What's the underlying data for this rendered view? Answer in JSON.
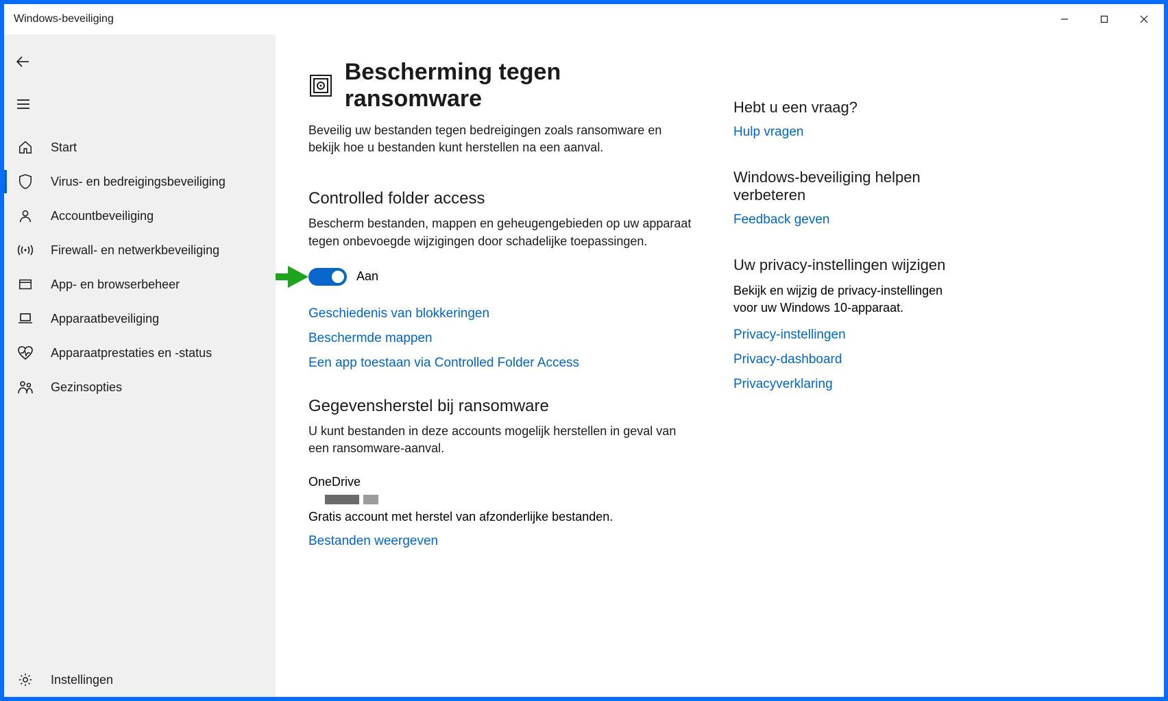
{
  "window": {
    "title": "Windows-beveiliging"
  },
  "sidebar": {
    "items": [
      {
        "label": "Start"
      },
      {
        "label": "Virus- en bedreigingsbeveiliging",
        "active": true
      },
      {
        "label": "Accountbeveiliging"
      },
      {
        "label": "Firewall- en netwerkbeveiliging"
      },
      {
        "label": "App- en browserbeheer"
      },
      {
        "label": "Apparaatbeveiliging"
      },
      {
        "label": "Apparaatprestaties en -status"
      },
      {
        "label": "Gezinsopties"
      }
    ],
    "settings_label": "Instellingen"
  },
  "main": {
    "title": "Bescherming tegen ransomware",
    "description": "Beveilig uw bestanden tegen bedreigingen zoals ransomware en bekijk hoe u bestanden kunt herstellen na een aanval.",
    "controlled_folder": {
      "title": "Controlled folder access",
      "description": "Bescherm bestanden, mappen en geheugengebieden op uw apparaat tegen onbevoegde wijzigingen door schadelijke toepassingen.",
      "toggle_state": "Aan",
      "links": [
        "Geschiedenis van blokkeringen",
        "Beschermde mappen",
        "Een app toestaan via Controlled Folder Access"
      ]
    },
    "recovery": {
      "title": "Gegevensherstel bij ransomware",
      "description": "U kunt bestanden in deze accounts mogelijk herstellen in geval van een ransomware-aanval.",
      "onedrive_label": "OneDrive",
      "onedrive_desc": "Gratis account met herstel van afzonderlijke bestanden.",
      "view_files": "Bestanden weergeven"
    }
  },
  "side": {
    "help": {
      "heading": "Hebt u een vraag?",
      "link": "Hulp vragen"
    },
    "improve": {
      "heading": "Windows-beveiliging helpen verbeteren",
      "link": "Feedback geven"
    },
    "privacy": {
      "heading": "Uw privacy-instellingen wijzigen",
      "text": "Bekijk en wijzig de privacy-instellingen voor uw Windows 10-apparaat.",
      "links": [
        "Privacy-instellingen",
        "Privacy-dashboard",
        "Privacyverklaring"
      ]
    }
  }
}
